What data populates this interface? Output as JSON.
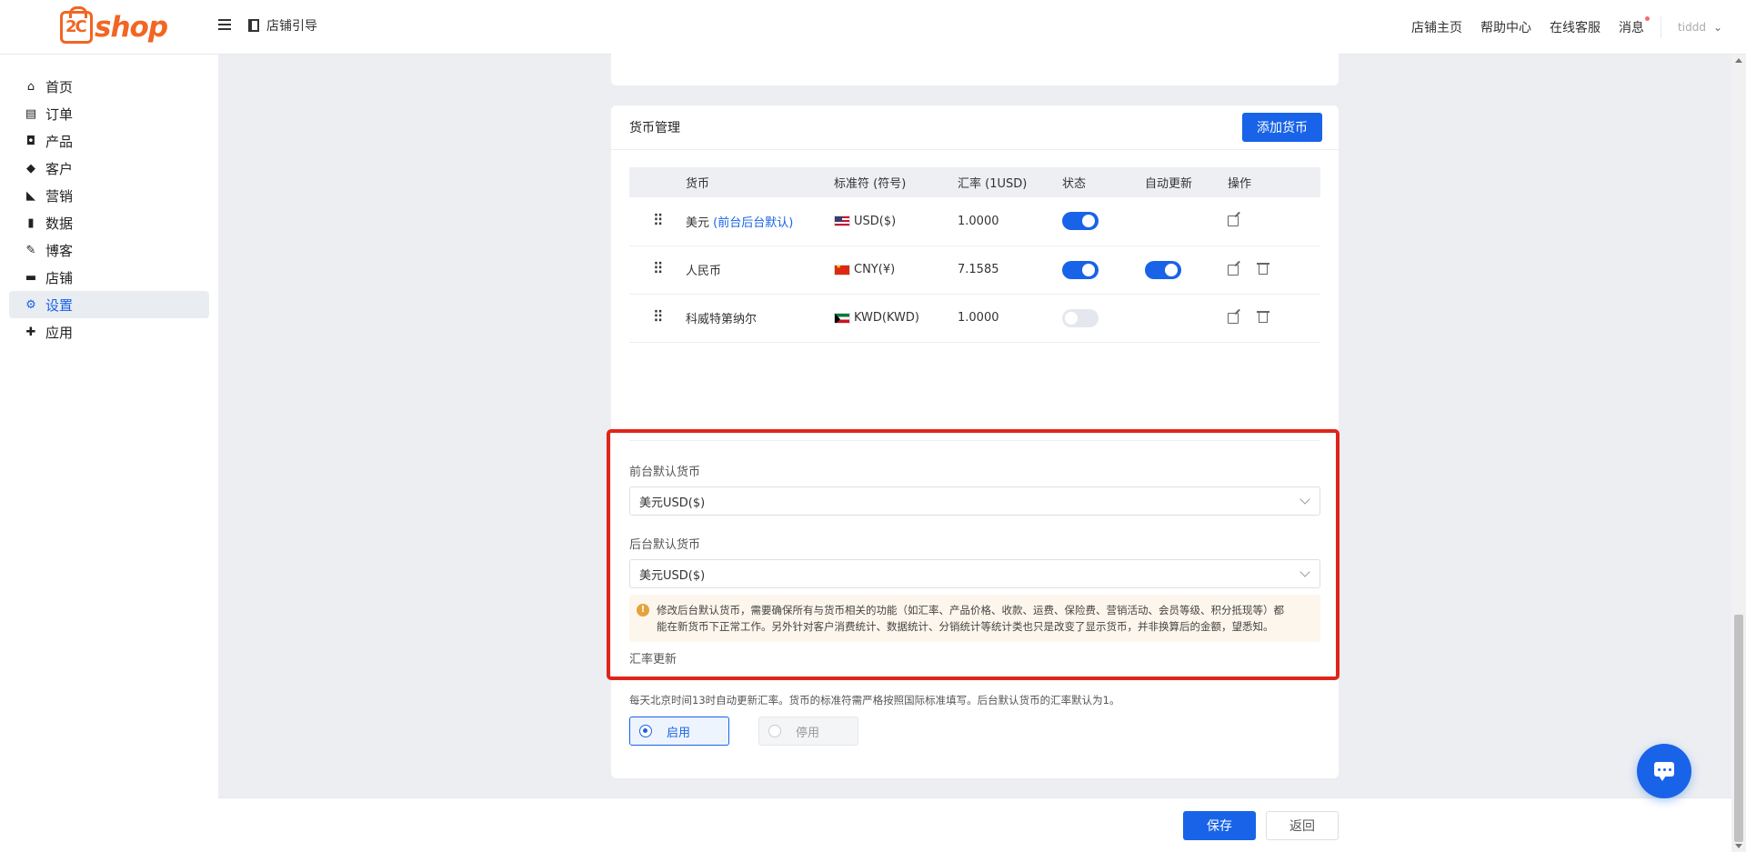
{
  "header": {
    "logo_text": "shop",
    "logo_mark": "2C",
    "guide_label": "店铺引导",
    "links": [
      "店铺主页",
      "帮助中心",
      "在线客服",
      "消息"
    ],
    "user_name": "tiddd"
  },
  "sidebar": {
    "items": [
      {
        "label": "首页",
        "icon": "home-icon",
        "glyph": "⌂"
      },
      {
        "label": "订单",
        "icon": "clipboard-icon",
        "glyph": "▤"
      },
      {
        "label": "产品",
        "icon": "bag-icon",
        "glyph": "◘"
      },
      {
        "label": "客户",
        "icon": "gem-icon",
        "glyph": "◆"
      },
      {
        "label": "营销",
        "icon": "tag-icon",
        "glyph": "◣"
      },
      {
        "label": "数据",
        "icon": "bar-chart-icon",
        "glyph": "▮"
      },
      {
        "label": "博客",
        "icon": "edit-icon",
        "glyph": "✎"
      },
      {
        "label": "店铺",
        "icon": "store-icon",
        "glyph": "▬"
      },
      {
        "label": "设置",
        "icon": "gear-icon",
        "glyph": "⚙"
      },
      {
        "label": "应用",
        "icon": "puzzle-icon",
        "glyph": "✚"
      }
    ],
    "active": "设置"
  },
  "currency": {
    "title": "货币管理",
    "add_button": "添加货币",
    "columns": [
      "货币",
      "标准符 (符号)",
      "汇率 (1USD)",
      "状态",
      "自动更新",
      "操作"
    ],
    "rows": [
      {
        "name": "美元",
        "tag": "(前台后台默认)",
        "code": "USD($)",
        "flag": "flag-us",
        "rate": "1.0000",
        "status": true,
        "auto_update": null,
        "deletable": false
      },
      {
        "name": "人民币",
        "tag": "",
        "code": "CNY(¥)",
        "flag": "flag-cn",
        "rate": "7.1585",
        "status": true,
        "auto_update": true,
        "deletable": true
      },
      {
        "name": "科威特第纳尔",
        "tag": "",
        "code": "KWD(KWD)",
        "flag": "flag-kw",
        "rate": "1.0000",
        "status": false,
        "auto_update": null,
        "deletable": true
      }
    ],
    "front_default_label": "前台默认货币",
    "front_default_value": "美元USD($)",
    "back_default_label": "后台默认货币",
    "back_default_value": "美元USD($)",
    "notice_line1": "修改后台默认货币，需要确保所有与货币相关的功能（如汇率、产品价格、收款、运费、保险费、营销活动、会员等级、积分抵现等）都",
    "notice_line2": "能在新货币下正常工作。另外针对客户消费统计、数据统计、分销统计等统计类也只是改变了显示货币，并非换算后的金额，望悉知。",
    "auto_title": "汇率更新",
    "auto_desc": "每天北京时间13时自动更新汇率。货币的标准符需严格按照国际标准填写。后台默认货币的汇率默认为1。",
    "radio_on": "启用",
    "radio_off": "停用"
  },
  "footer": {
    "save": "保存",
    "back": "返回"
  },
  "colors": {
    "primary": "#1863e8",
    "brand": "#f26522",
    "highlight": "#e0241a"
  }
}
